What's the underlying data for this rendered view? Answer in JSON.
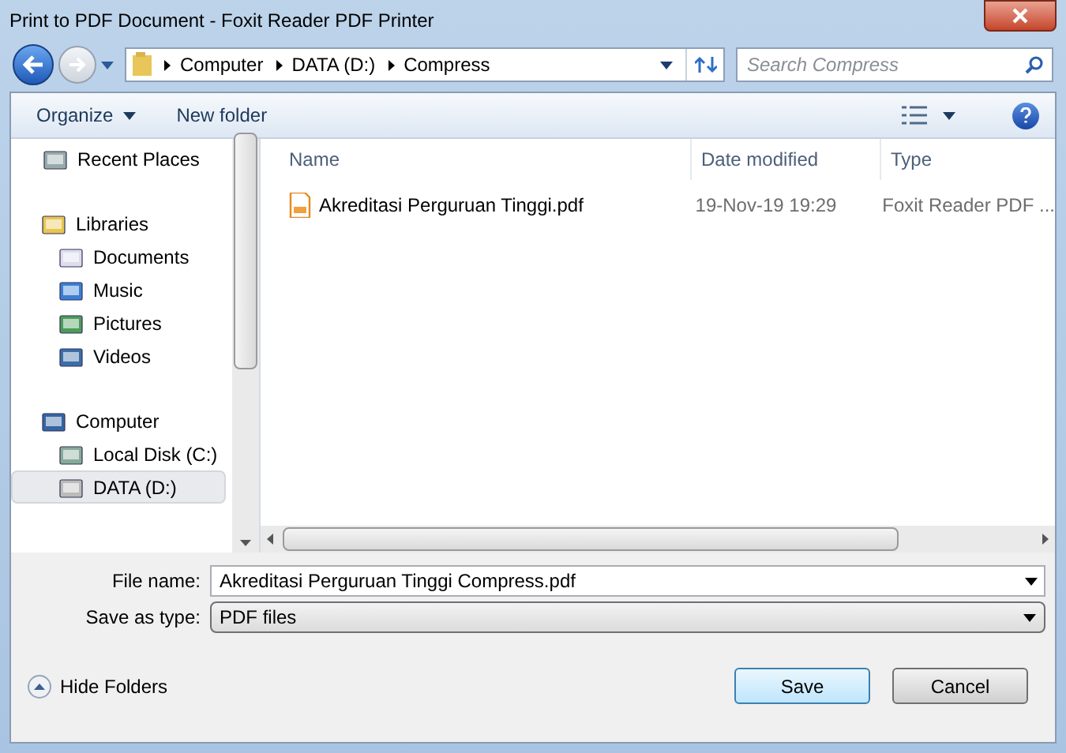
{
  "window": {
    "title": "Print to PDF Document - Foxit Reader PDF Printer"
  },
  "breadcrumb": [
    "Computer",
    "DATA (D:)",
    "Compress"
  ],
  "search": {
    "placeholder": "Search Compress"
  },
  "toolbar": {
    "organize": "Organize",
    "new_folder": "New folder"
  },
  "sidebar": {
    "groups": [
      {
        "items": [
          {
            "label": "Recent Places",
            "selected": false
          }
        ]
      },
      {
        "label": "Libraries",
        "selected": false,
        "items": [
          {
            "label": "Documents",
            "selected": false
          },
          {
            "label": "Music",
            "selected": false
          },
          {
            "label": "Pictures",
            "selected": false
          },
          {
            "label": "Videos",
            "selected": false
          }
        ]
      },
      {
        "label": "Computer",
        "selected": false,
        "items": [
          {
            "label": "Local Disk (C:)",
            "selected": false
          },
          {
            "label": "DATA (D:)",
            "selected": true
          }
        ]
      }
    ]
  },
  "table": {
    "columns": [
      "Name",
      "Date modified",
      "Type"
    ],
    "rows": [
      {
        "name": "Akreditasi Perguruan Tinggi.pdf",
        "date": "19-Nov-19 19:29",
        "type": "Foxit Reader PDF ..."
      }
    ]
  },
  "form": {
    "file_name_label": "File name:",
    "file_name": "Akreditasi Perguruan Tinggi Compress.pdf",
    "type_label": "Save as type:",
    "type": "PDF files"
  },
  "hide_folders": "Hide Folders",
  "buttons": {
    "save": "Save",
    "cancel": "Cancel"
  }
}
